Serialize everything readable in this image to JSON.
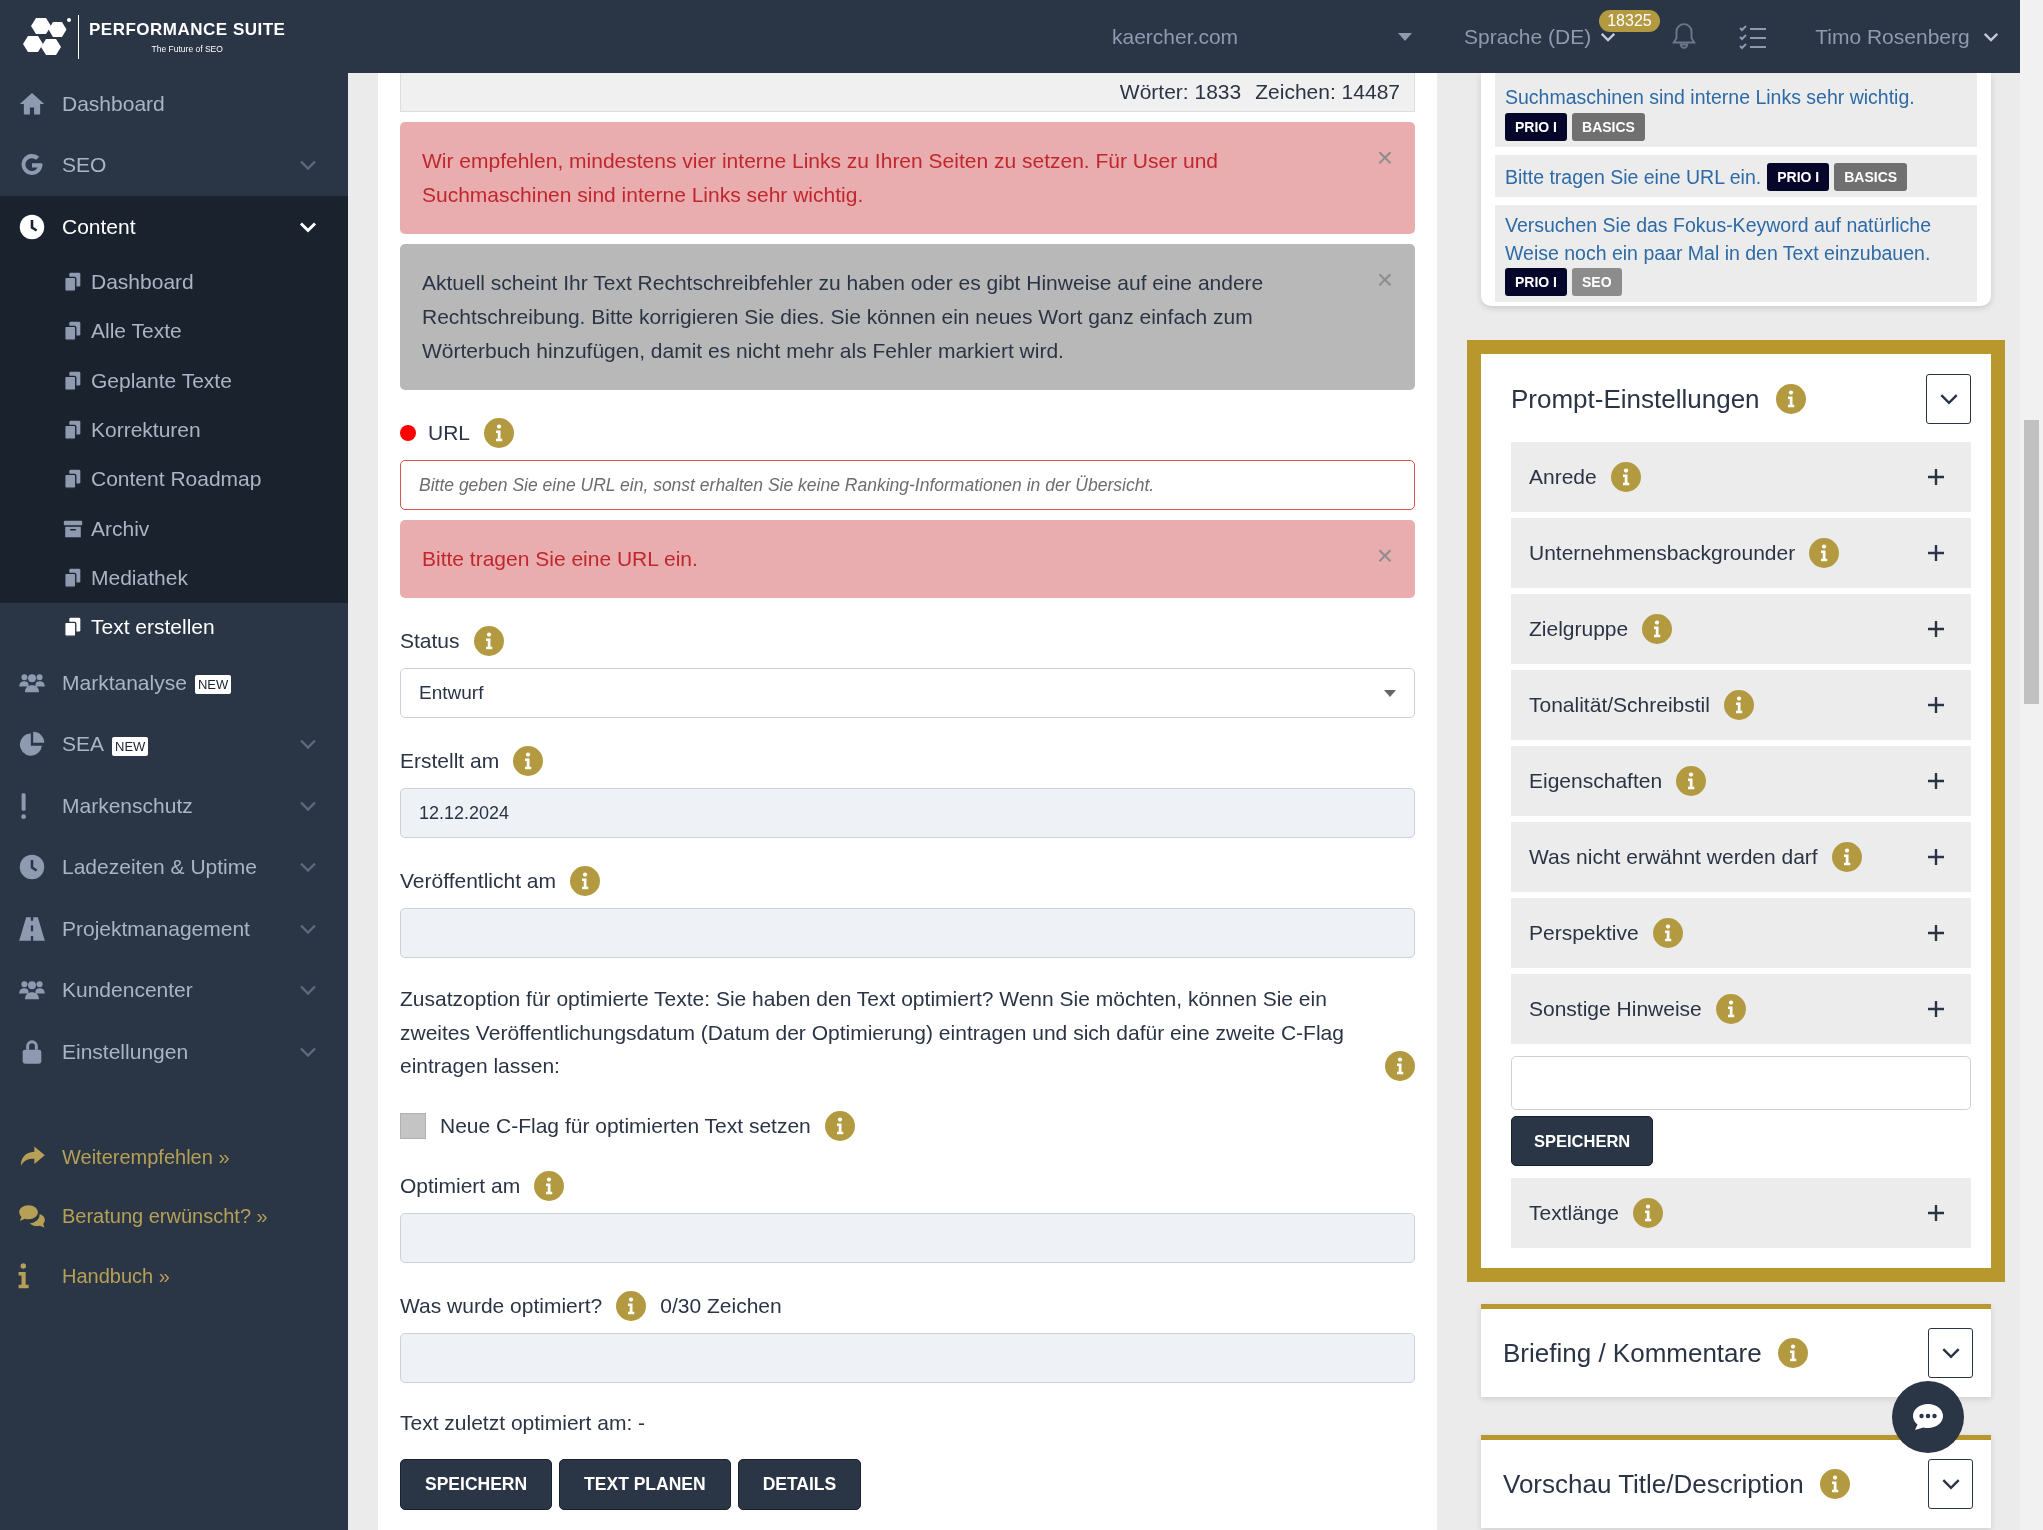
{
  "header": {
    "logo_title": "PERFORMANCE SUITE",
    "logo_subtitle": "The Future of SEO",
    "domain": "kaercher.com",
    "language": "Sprache (DE)",
    "notification_count": "18325",
    "user": "Timo Rosenberg"
  },
  "sidebar": {
    "items": [
      {
        "label": "Dashboard",
        "kind": "home"
      },
      {
        "label": "SEO",
        "kind": "google",
        "expanded": false
      },
      {
        "label": "Content",
        "kind": "clock",
        "expanded": true,
        "children": [
          {
            "label": "Dashboard",
            "kind": "copy",
            "selected": false
          },
          {
            "label": "Alle Texte",
            "kind": "copy",
            "selected": false
          },
          {
            "label": "Geplante Texte",
            "kind": "copy",
            "selected": false
          },
          {
            "label": "Korrekturen",
            "kind": "copy",
            "selected": false
          },
          {
            "label": "Content Roadmap",
            "kind": "copy",
            "selected": false
          },
          {
            "label": "Archiv",
            "kind": "archive",
            "selected": false
          },
          {
            "label": "Mediathek",
            "kind": "copy",
            "selected": false
          },
          {
            "label": "Text erstellen",
            "kind": "copy",
            "selected": true
          }
        ]
      },
      {
        "label": "Marktanalyse",
        "kind": "users",
        "badge": "NEW"
      },
      {
        "label": "SEA",
        "kind": "pie",
        "badge": "NEW",
        "expanded": false
      },
      {
        "label": "Markenschutz",
        "kind": "exclamation",
        "expanded": false
      },
      {
        "label": "Ladezeiten & Uptime",
        "kind": "clock",
        "expanded": false
      },
      {
        "label": "Projektmanagement",
        "kind": "road",
        "expanded": false
      },
      {
        "label": "Kundencenter",
        "kind": "users",
        "expanded": false
      },
      {
        "label": "Einstellungen",
        "kind": "lock",
        "expanded": false
      }
    ],
    "links": [
      {
        "label": "Weiterempfehlen »",
        "kind": "share"
      },
      {
        "label": "Beratung erwünscht? »",
        "kind": "chat"
      },
      {
        "label": "Handbuch »",
        "kind": "info"
      }
    ]
  },
  "editor_stats": {
    "words": "Wörter: 1833",
    "characters": "Zeichen: 14487"
  },
  "form": [
    {
      "kind": "danger_alert",
      "text": "Wir empfehlen, mindestens vier interne Links zu Ihren Seiten zu setzen. Für User und Suchmaschinen sind interne Links sehr wichtig.",
      "close": "×"
    },
    {
      "kind": "note_alert",
      "text": "Aktuell scheint Ihr Text Rechtschreibfehler zu haben oder es gibt Hinweise auf eine andere Rechtschreibung. Bitte korrigieren Sie dies. Sie können ein neues Wort ganz einfach zum Wörterbuch hinzufügen, damit es nicht mehr als Fehler markiert wird.",
      "close": "×"
    },
    {
      "kind": "text_field",
      "label": "URL",
      "required": true,
      "invalid": true,
      "placeholder": "Bitte geben Sie eine URL ein, sonst erhalten Sie keine Ranking-Informationen in der Übersicht."
    },
    {
      "kind": "danger_alert",
      "text": "Bitte tragen Sie eine URL ein.",
      "close": "×"
    },
    {
      "kind": "select_field",
      "label": "Status",
      "value": "Entwurf"
    },
    {
      "kind": "text_field",
      "label": "Erstellt am",
      "disabled": true,
      "value": "12.12.2024"
    },
    {
      "kind": "text_field",
      "label": "Veröffentlicht am",
      "disabled": true
    },
    {
      "kind": "paragraph",
      "text": "Zusatzoption für optimierte Texte: Sie haben den Text optimiert? Wenn Sie möchten, können Sie ein zweites Veröffentlichungsdatum (Datum der Optimierung) eintragen und sich dafür eine zweite C-Flag eintragen lassen:"
    },
    {
      "kind": "checkbox",
      "label": "Neue C-Flag für optimierten Text setzen",
      "checked": false
    },
    {
      "kind": "text_field",
      "label": "Optimiert am",
      "disabled": true
    },
    {
      "kind": "text_field",
      "label": "Was wurde optimiert?",
      "disabled": true,
      "counter": "0/30 Zeichen"
    },
    {
      "kind": "note",
      "text": "Text zuletzt optimiert am: -"
    },
    {
      "kind": "buttons",
      "buttons": [
        "SPEICHERN",
        "TEXT PLANEN",
        "DETAILS"
      ]
    }
  ],
  "hints": [
    {
      "text": "Suchmaschinen sind interne Links sehr wichtig.",
      "tags": [
        {
          "label": "PRIO I",
          "color": "#05062a"
        },
        {
          "label": "BASICS",
          "color": "#707070"
        }
      ]
    },
    {
      "text": "Bitte tragen Sie eine URL ein.",
      "tags": [
        {
          "label": "PRIO I",
          "color": "#05062a"
        },
        {
          "label": "BASICS",
          "color": "#707070"
        }
      ]
    },
    {
      "text": "Versuchen Sie das Fokus-Keyword auf natürliche Weise noch ein paar Mal in den Text einzubauen.",
      "tags": [
        {
          "label": "PRIO I",
          "color": "#05062a"
        },
        {
          "label": "SEO",
          "color": "#8c8c8c"
        }
      ]
    }
  ],
  "prompt_settings": {
    "title": "Prompt-Einstellungen",
    "items": [
      {
        "label": "Anrede"
      },
      {
        "label": "Unternehmensbackgrounder"
      },
      {
        "label": "Zielgruppe"
      },
      {
        "label": "Tonalität/Schreibstil"
      },
      {
        "label": "Eigenschaften"
      },
      {
        "label": "Was nicht erwähnt werden darf"
      },
      {
        "label": "Perspektive"
      },
      {
        "label": "Sonstige Hinweise"
      }
    ],
    "save_button": "SPEICHERN",
    "after_items": [
      {
        "label": "Textlänge"
      }
    ]
  },
  "sections": [
    {
      "title": "Briefing / Kommentare"
    },
    {
      "title": "Vorschau Title/Description"
    }
  ]
}
